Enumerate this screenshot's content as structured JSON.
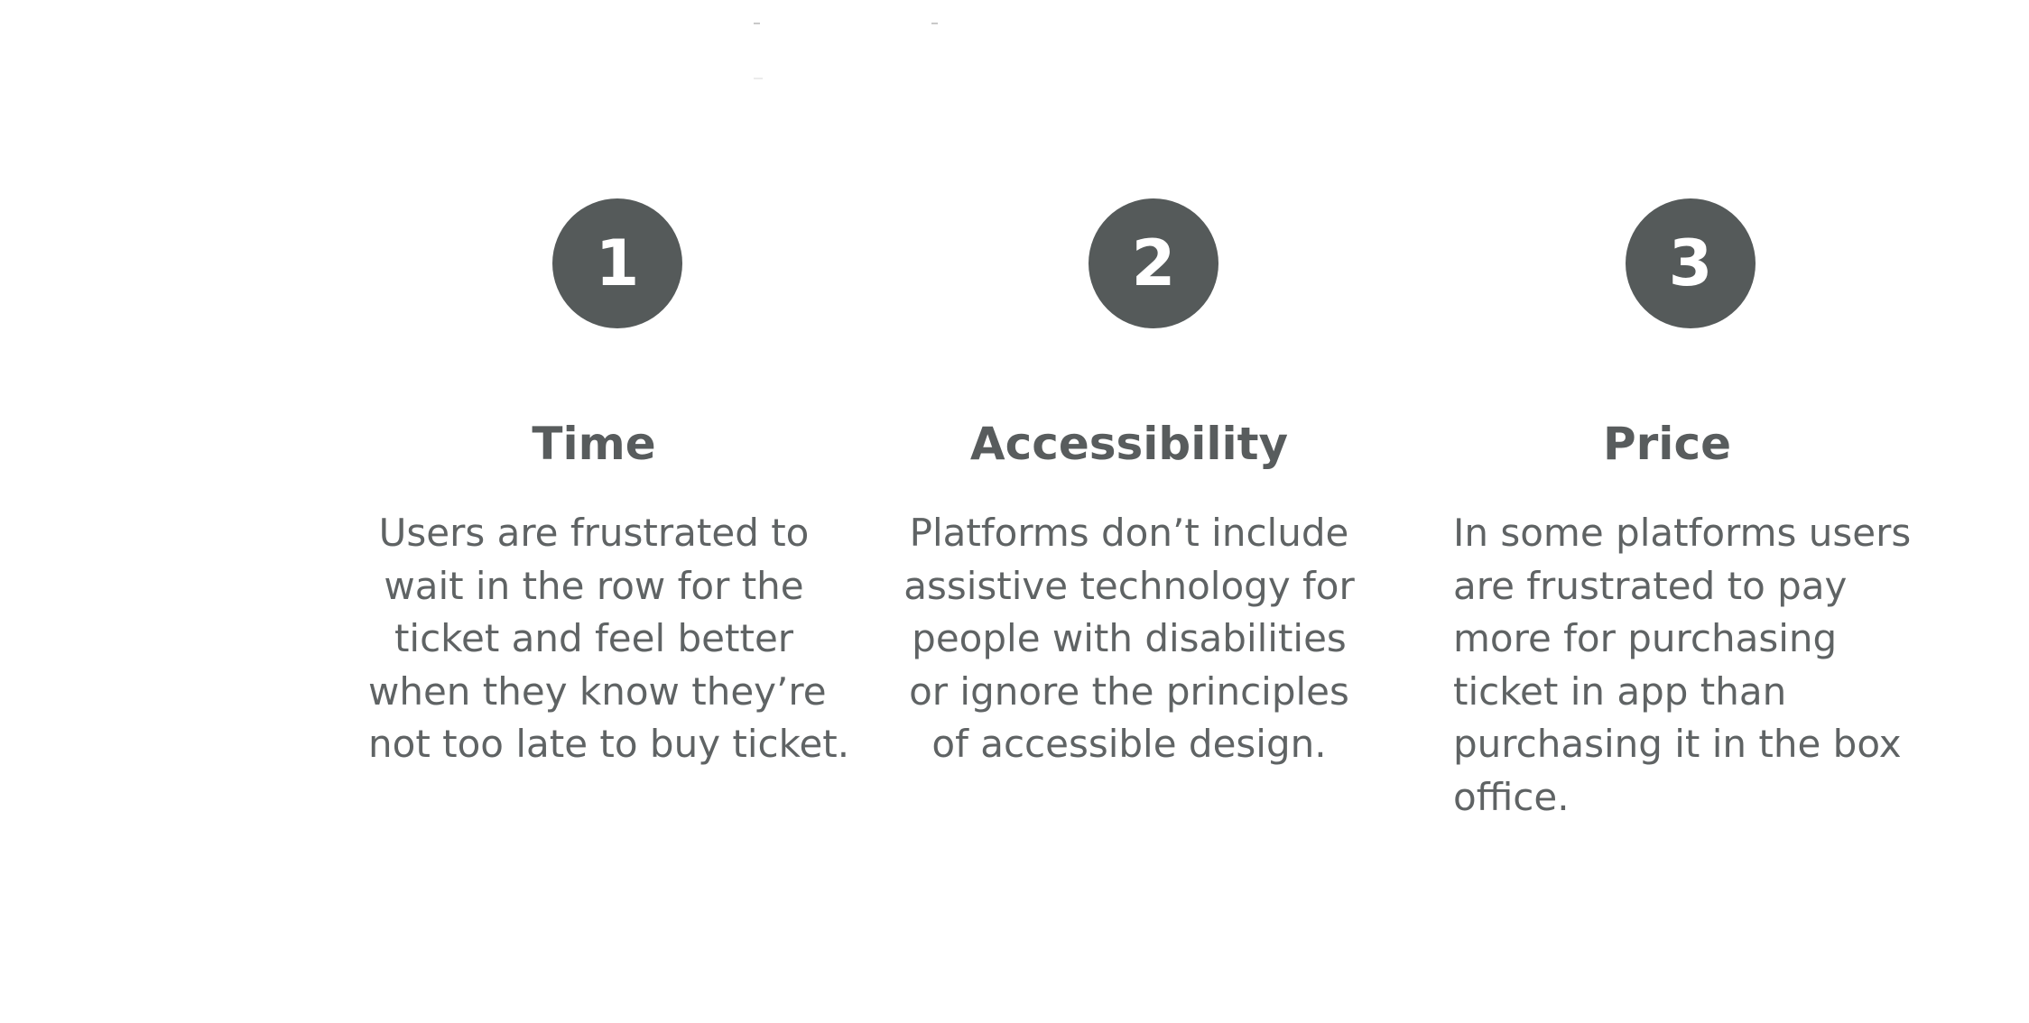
{
  "features": [
    {
      "number": "1",
      "title": "Time",
      "lines": [
        "Users are frustrated to",
        "wait in the row for the",
        "ticket and feel better",
        "when they know they’re",
        "not too late to buy ticket."
      ]
    },
    {
      "number": "2",
      "title": "Accessibility",
      "lines": [
        "Platforms don’t include",
        "assistive technology for",
        "people with disabilities",
        "or ignore the principles",
        "of accessible design."
      ]
    },
    {
      "number": "3",
      "title": "Price",
      "lines": [
        "In some platforms users",
        "are frustrated to pay",
        "more for purchasing",
        "ticket in app than",
        "purchasing it in the box",
        "office."
      ]
    }
  ],
  "colors": {
    "badge_background": "#555a5a",
    "badge_text": "#ffffff",
    "title_text": "#585c5d",
    "body_text": "#5f6364",
    "page_background": "#ffffff"
  }
}
